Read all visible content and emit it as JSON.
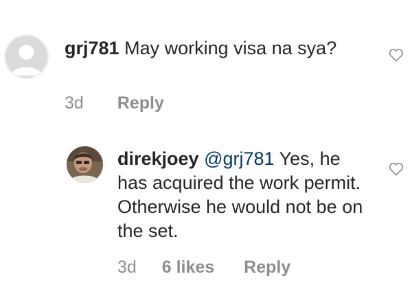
{
  "comments": [
    {
      "username": "grj781",
      "text": "May working visa na sya?",
      "time": "3d",
      "reply_label": "Reply",
      "avatar_icon": "default-avatar-icon",
      "like_icon": "heart-outline-icon"
    },
    {
      "username": "direkjoey",
      "mention": "@grj781",
      "text": "Yes, he has acquired the work permit. Otherwise he would not be on the set.",
      "time": "3d",
      "likes": "6 likes",
      "reply_label": "Reply",
      "avatar_icon": "user-photo-avatar",
      "like_icon": "heart-outline-icon"
    }
  ],
  "colors": {
    "text": "#262626",
    "secondary": "#8e8e8e",
    "mention": "#00376b",
    "avatar_placeholder": "#dbdbdb"
  }
}
